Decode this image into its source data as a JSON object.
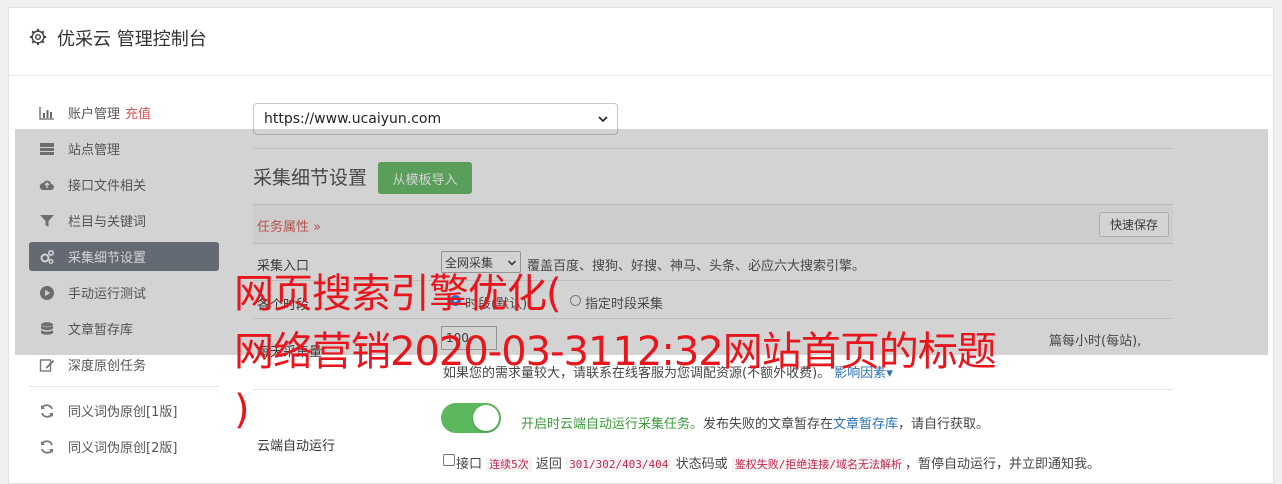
{
  "header": {
    "title": "优采云 管理控制台",
    "icon": "gear-icon"
  },
  "sidebar": {
    "items": [
      {
        "label": "账户管理",
        "extra": "充值",
        "icon": "bar-chart-icon"
      },
      {
        "label": "站点管理",
        "icon": "server-icon"
      },
      {
        "label": "接口文件相关",
        "icon": "cloud-upload-icon"
      },
      {
        "label": "栏目与关键词",
        "icon": "filter-icon"
      },
      {
        "label": "采集细节设置",
        "icon": "cogs-icon",
        "active": true
      },
      {
        "label": "手动运行测试",
        "icon": "play-circle-icon"
      },
      {
        "label": "文章暂存库",
        "icon": "database-icon"
      },
      {
        "label": "深度原创任务",
        "icon": "edit-icon"
      },
      {
        "label": "同义词伪原创[1版]",
        "icon": "refresh-icon"
      },
      {
        "label": "同义词伪原创[2版]",
        "icon": "refresh-icon"
      }
    ]
  },
  "site_select": {
    "value": "https://www.ucaiyun.com"
  },
  "section": {
    "title": "采集细节设置",
    "import_button": "从模板导入",
    "task_props": "任务属性",
    "quick_save": "快速保存"
  },
  "rows": {
    "entry": {
      "label": "采集入口",
      "select_value": "全网采集",
      "desc": "覆盖百度、搜狗、好搜、神马、头条、必应六大搜索引擎。"
    },
    "time": {
      "label": "各个时段",
      "option1": "时段(默认)",
      "option2": "指定时段采集"
    },
    "amount": {
      "label": "每天采集量",
      "value": "100",
      "desc_tail": "篇每小时(每站),",
      "desc2": "如果您的需求量较大，请联系在线客服为您调配资源(不额外收费)。",
      "link": "影响因素"
    },
    "cloud": {
      "label": "云端自动运行",
      "toggle_on": true,
      "desc_green": "开启时云端自动运行采集任务。",
      "desc_mid": "发布失败的文章暂存在",
      "desc_link": "文章暂存库",
      "desc_tail": "，请自行获取。",
      "chk_label": "接口",
      "code1": "连续5次",
      "mid1": "返回",
      "code2": "301/302/403/404",
      "mid2": "状态码或",
      "code3": "鉴权失败/拒绝连接/域名无法解析",
      "tail": "，暂停自动运行，并立即通知我。"
    }
  },
  "overlay_text": {
    "line1": "网页搜索引擎优化(",
    "line2": "网络营销2020-03-3112:32网站首页的标题",
    "line3": ")"
  }
}
